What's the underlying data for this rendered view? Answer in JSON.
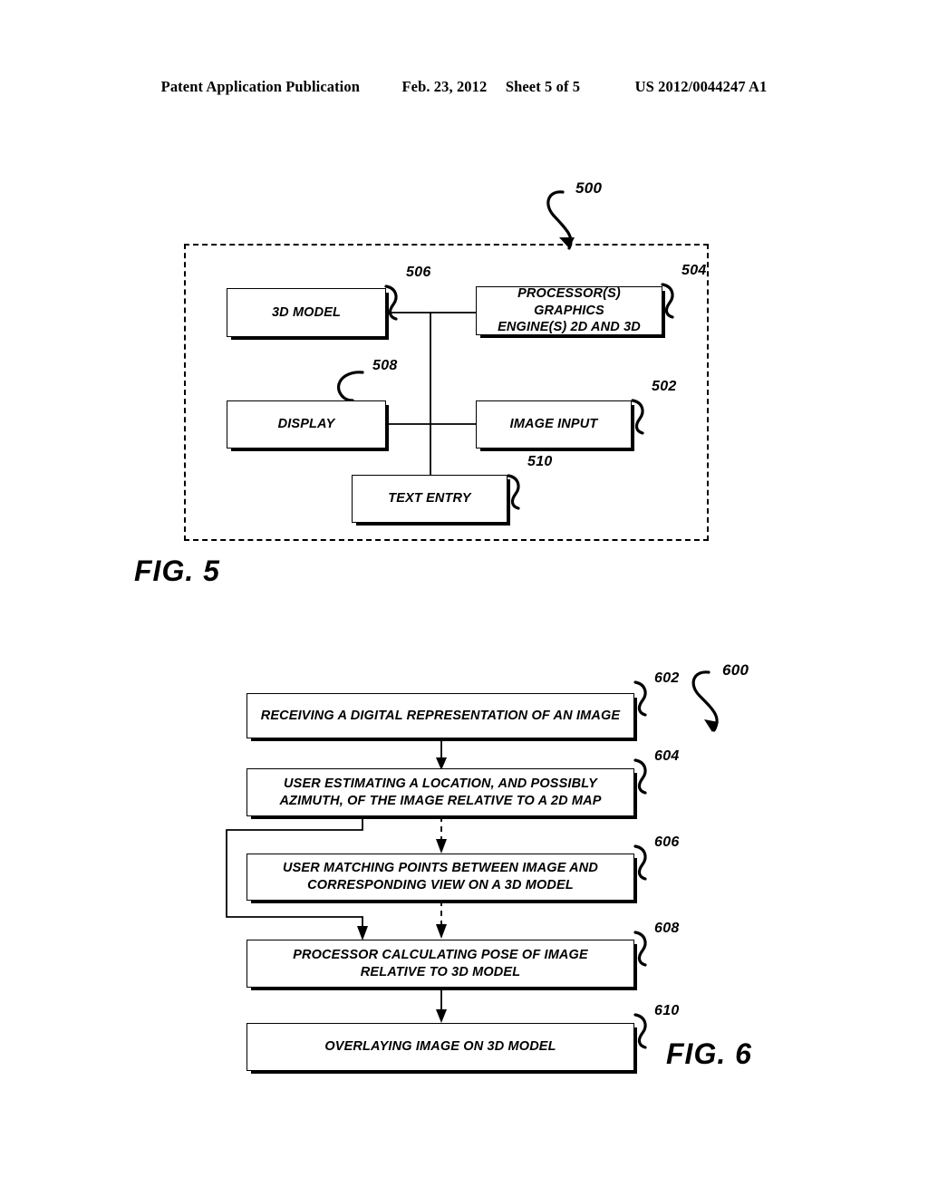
{
  "header": {
    "publication": "Patent Application Publication",
    "date": "Feb. 23, 2012",
    "sheet": "Sheet 5 of 5",
    "docnumber": "US 2012/0044247 A1"
  },
  "figures": [
    {
      "caption": "FIG. 5",
      "system_ref": "500",
      "enclosure": "dashed-system-boundary",
      "blocks": [
        {
          "ref": "506",
          "label": "3D MODEL"
        },
        {
          "ref": "504",
          "label": "PROCESSOR(S) GRAPHICS\nENGINE(S) 2D AND 3D"
        },
        {
          "ref": "508",
          "label": "DISPLAY"
        },
        {
          "ref": "502",
          "label": "IMAGE INPUT"
        },
        {
          "ref": "510",
          "label": "TEXT ENTRY"
        }
      ]
    },
    {
      "caption": "FIG. 6",
      "system_ref": "600",
      "blocks": [
        {
          "ref": "602",
          "label": "RECEIVING A DIGITAL REPRESENTATION OF AN IMAGE"
        },
        {
          "ref": "604",
          "label": "USER ESTIMATING A LOCATION, AND POSSIBLY\nAZIMUTH, OF THE IMAGE RELATIVE TO A 2D MAP"
        },
        {
          "ref": "606",
          "label": "USER MATCHING POINTS BETWEEN IMAGE AND\nCORRESPONDING VIEW ON A 3D MODEL"
        },
        {
          "ref": "608",
          "label": "PROCESSOR CALCULATING POSE OF IMAGE\nRELATIVE TO 3D MODEL"
        },
        {
          "ref": "610",
          "label": "OVERLAYING IMAGE ON 3D MODEL"
        }
      ]
    }
  ],
  "colors": {
    "ink": "#000000",
    "paper": "#ffffff"
  }
}
